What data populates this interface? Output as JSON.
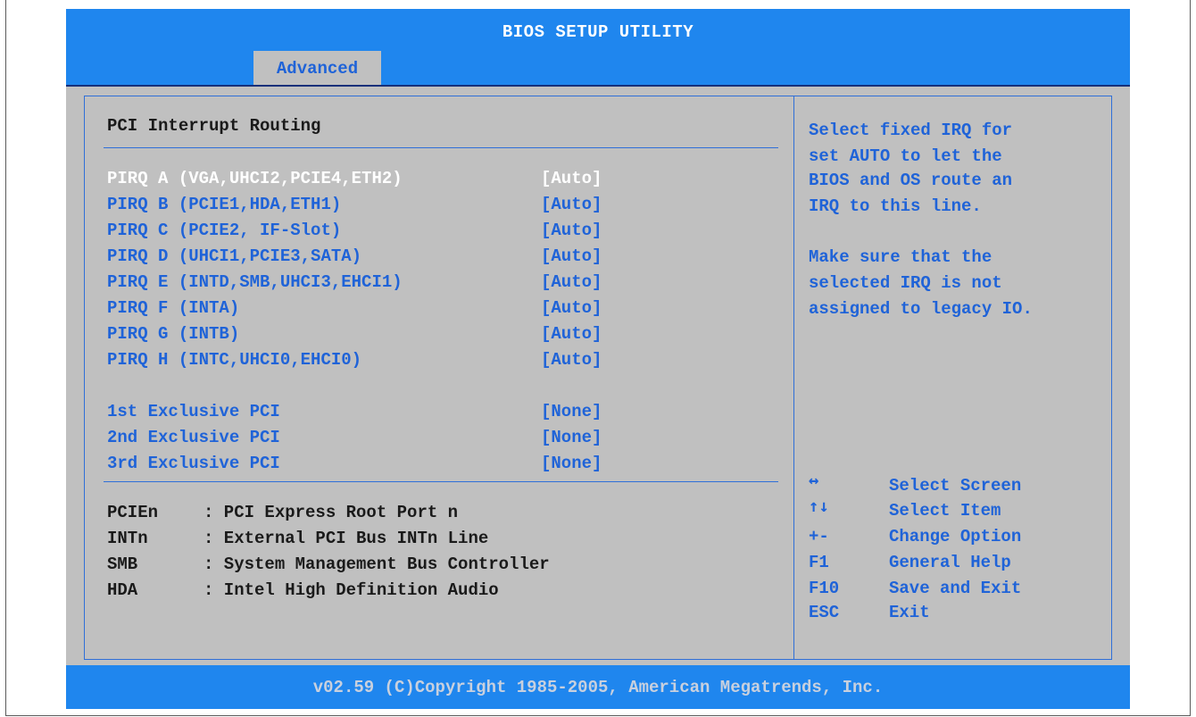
{
  "title": "BIOS SETUP UTILITY",
  "tabs": [
    {
      "label": "Advanced"
    }
  ],
  "section": {
    "heading": "PCI Interrupt Routing"
  },
  "pirq_items": [
    {
      "label": "PIRQ A (VGA,UHCI2,PCIE4,ETH2)",
      "value": "[Auto]"
    },
    {
      "label": "PIRQ B (PCIE1,HDA,ETH1)",
      "value": "[Auto]"
    },
    {
      "label": "PIRQ C (PCIE2, IF-Slot)",
      "value": "[Auto]"
    },
    {
      "label": "PIRQ D (UHCI1,PCIE3,SATA)",
      "value": "[Auto]"
    },
    {
      "label": "PIRQ E (INTD,SMB,UHCI3,EHCI1)",
      "value": "[Auto]"
    },
    {
      "label": "PIRQ F (INTA)",
      "value": "[Auto]"
    },
    {
      "label": "PIRQ G (INTB)",
      "value": "[Auto]"
    },
    {
      "label": "PIRQ H (INTC,UHCI0,EHCI0)",
      "value": "[Auto]"
    }
  ],
  "exclusive_items": [
    {
      "label": "1st Exclusive PCI",
      "value": "[None]"
    },
    {
      "label": "2nd Exclusive PCI",
      "value": "[None]"
    },
    {
      "label": "3rd Exclusive PCI",
      "value": "[None]"
    }
  ],
  "legend": [
    {
      "abbr": "PCIEn",
      "desc": ": PCI Express Root Port n"
    },
    {
      "abbr": "INTn",
      "desc": ": External PCI Bus INTn Line"
    },
    {
      "abbr": "SMB",
      "desc": ": System Management Bus Controller"
    },
    {
      "abbr": "HDA",
      "desc": ": Intel High Definition Audio"
    }
  ],
  "help": {
    "lines1": [
      "Select fixed IRQ for",
      "set AUTO to let the",
      "BIOS and OS route an",
      "IRQ to this line."
    ],
    "lines2": [
      "Make sure that the",
      "selected IRQ is not",
      "assigned to legacy IO."
    ]
  },
  "keys": [
    {
      "key": "↔",
      "action": "Select Screen"
    },
    {
      "key": "↑↓",
      "action": "Select Item"
    },
    {
      "key": "+-",
      "action": "Change Option"
    },
    {
      "key": "F1",
      "action": "General Help"
    },
    {
      "key": "F10",
      "action": "Save and Exit"
    },
    {
      "key": "ESC",
      "action": "Exit"
    }
  ],
  "footer": "v02.59 (C)Copyright 1985-2005, American Megatrends, Inc."
}
